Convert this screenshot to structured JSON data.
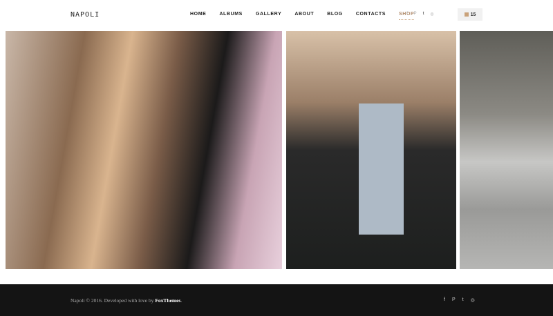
{
  "header": {
    "logo": "NAPOLI",
    "nav": [
      "HOME",
      "ALBUMS",
      "GALLERY",
      "ABOUT",
      "BLOG",
      "CONTACTS",
      "SHOP"
    ],
    "active": "SHOP",
    "social": [
      "f",
      "P",
      "t",
      "◎"
    ],
    "cart_count": "15",
    "accent": "#c9a27a"
  },
  "gallery": [
    "portrait-woman-magnolia",
    "woman-black-hat-coat",
    "street-wall"
  ],
  "footer": {
    "copy_prefix": "Napoli © 2016. Developed with love by ",
    "brand": "FoxThemes",
    "copy_suffix": ".",
    "social": [
      "f",
      "P",
      "t",
      "◎"
    ]
  }
}
